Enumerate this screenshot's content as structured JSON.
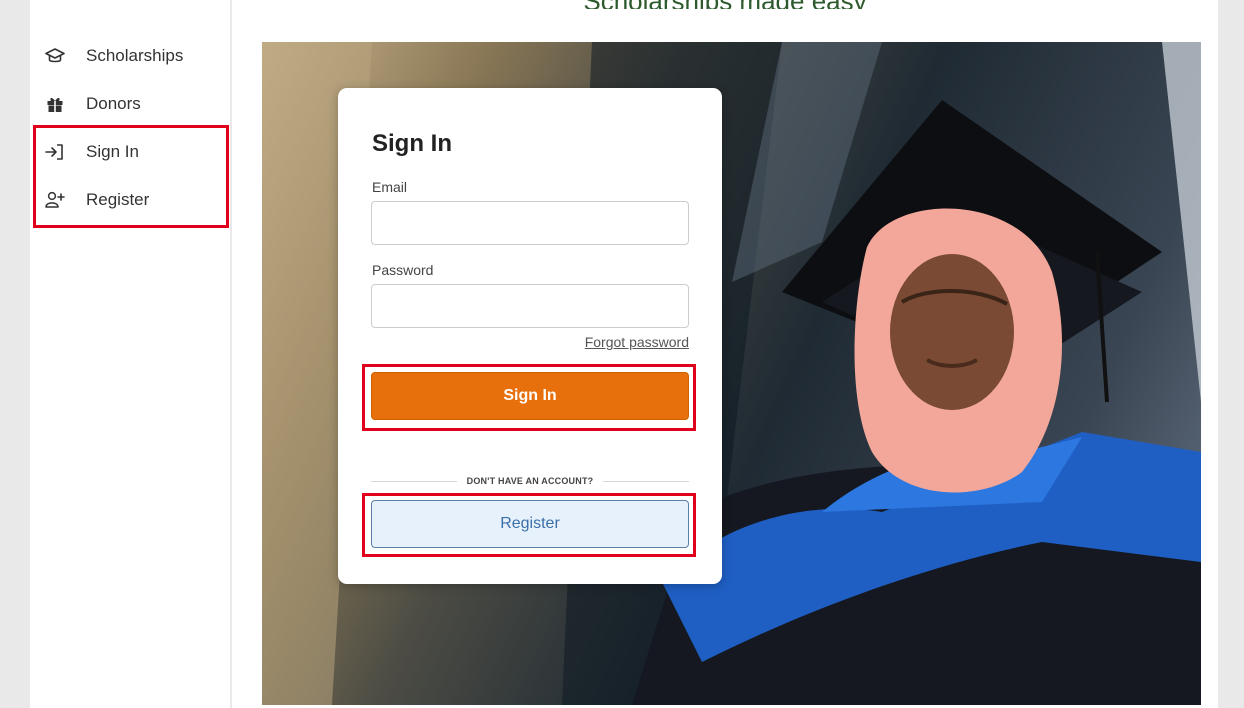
{
  "header": {
    "title": "Scholarships made easy"
  },
  "sidebar": {
    "items": [
      {
        "label": "Scholarships",
        "icon": "graduation-cap-icon"
      },
      {
        "label": "Donors",
        "icon": "gift-icon"
      },
      {
        "label": "Sign In",
        "icon": "sign-in-icon"
      },
      {
        "label": "Register",
        "icon": "user-plus-icon"
      }
    ]
  },
  "signin": {
    "title": "Sign In",
    "email_label": "Email",
    "email_value": "",
    "password_label": "Password",
    "password_value": "",
    "forgot_label": "Forgot password",
    "submit_label": "Sign In",
    "divider_text": "DON'T HAVE AN ACCOUNT?",
    "register_label": "Register"
  },
  "colors": {
    "accent": "#e8700c",
    "register_bg": "#e6f1fc",
    "register_text": "#3a6fa8",
    "highlight": "#e0001b"
  }
}
